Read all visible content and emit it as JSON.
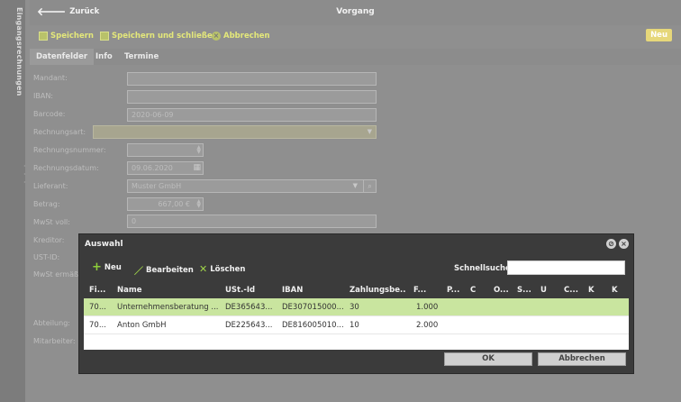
{
  "sidebar": {
    "label": "Eingangsrechnungen",
    "handle": "· · ·"
  },
  "header": {
    "back_label": "Zurück",
    "title": "Vorgang"
  },
  "toolbar": {
    "save_label": "Speichern",
    "save_close_label": "Speichern und schließen",
    "cancel_label": "Abbrechen",
    "new_label": "Neu"
  },
  "tabs": [
    {
      "label": "Datenfelder"
    },
    {
      "label": "Info"
    },
    {
      "label": "Termine"
    }
  ],
  "form": {
    "mandant": {
      "label": "Mandant:",
      "value": ""
    },
    "iban": {
      "label": "IBAN:",
      "value": ""
    },
    "barcode": {
      "label": "Barcode:",
      "value": "2020-06-09"
    },
    "rechnungsart": {
      "label": "Rechnungsart:",
      "value": ""
    },
    "rechnungsnummer": {
      "label": "Rechnungsnummer:",
      "value": ""
    },
    "rechnungsdatum": {
      "label": "Rechnungsdatum:",
      "value": "09.06.2020"
    },
    "lieferant": {
      "label": "Lieferant:",
      "value": "Muster GmbH"
    },
    "betrag": {
      "label": "Betrag:",
      "value": "667,00 €"
    },
    "mwst_voll": {
      "label": "MwSt voll:",
      "value": "0"
    },
    "kreditor": {
      "label": "Kreditor:"
    },
    "ust_id": {
      "label": "UST-ID:"
    },
    "mwst_erm": {
      "label": "MwSt ermäß"
    },
    "abteilung": {
      "label": "Abteilung:"
    },
    "mitarbeiter": {
      "label": "Mitarbeiter:"
    }
  },
  "modal": {
    "title": "Auswahl",
    "buttons": {
      "new": "Neu",
      "edit": "Bearbeiten",
      "delete": "Löschen"
    },
    "quicksearch": {
      "label": "Schnellsuche",
      "value": ""
    },
    "columns": [
      "Fi...",
      "Name",
      "USt.-Id",
      "IBAN",
      "Zahlungsbe...",
      "F...",
      "P...",
      "C",
      "O...",
      "S...",
      "U",
      "C...",
      "K",
      "K"
    ],
    "rows": [
      [
        "70...",
        "Unternehmensberatung ...",
        "DE365643...",
        "DE307015000...",
        "30",
        "1.000"
      ],
      [
        "70...",
        "Anton GmbH",
        "DE225643...",
        "DE816005010...",
        "10",
        "2.000"
      ]
    ],
    "ok_label": "OK",
    "cancel_label": "Abbrechen"
  }
}
